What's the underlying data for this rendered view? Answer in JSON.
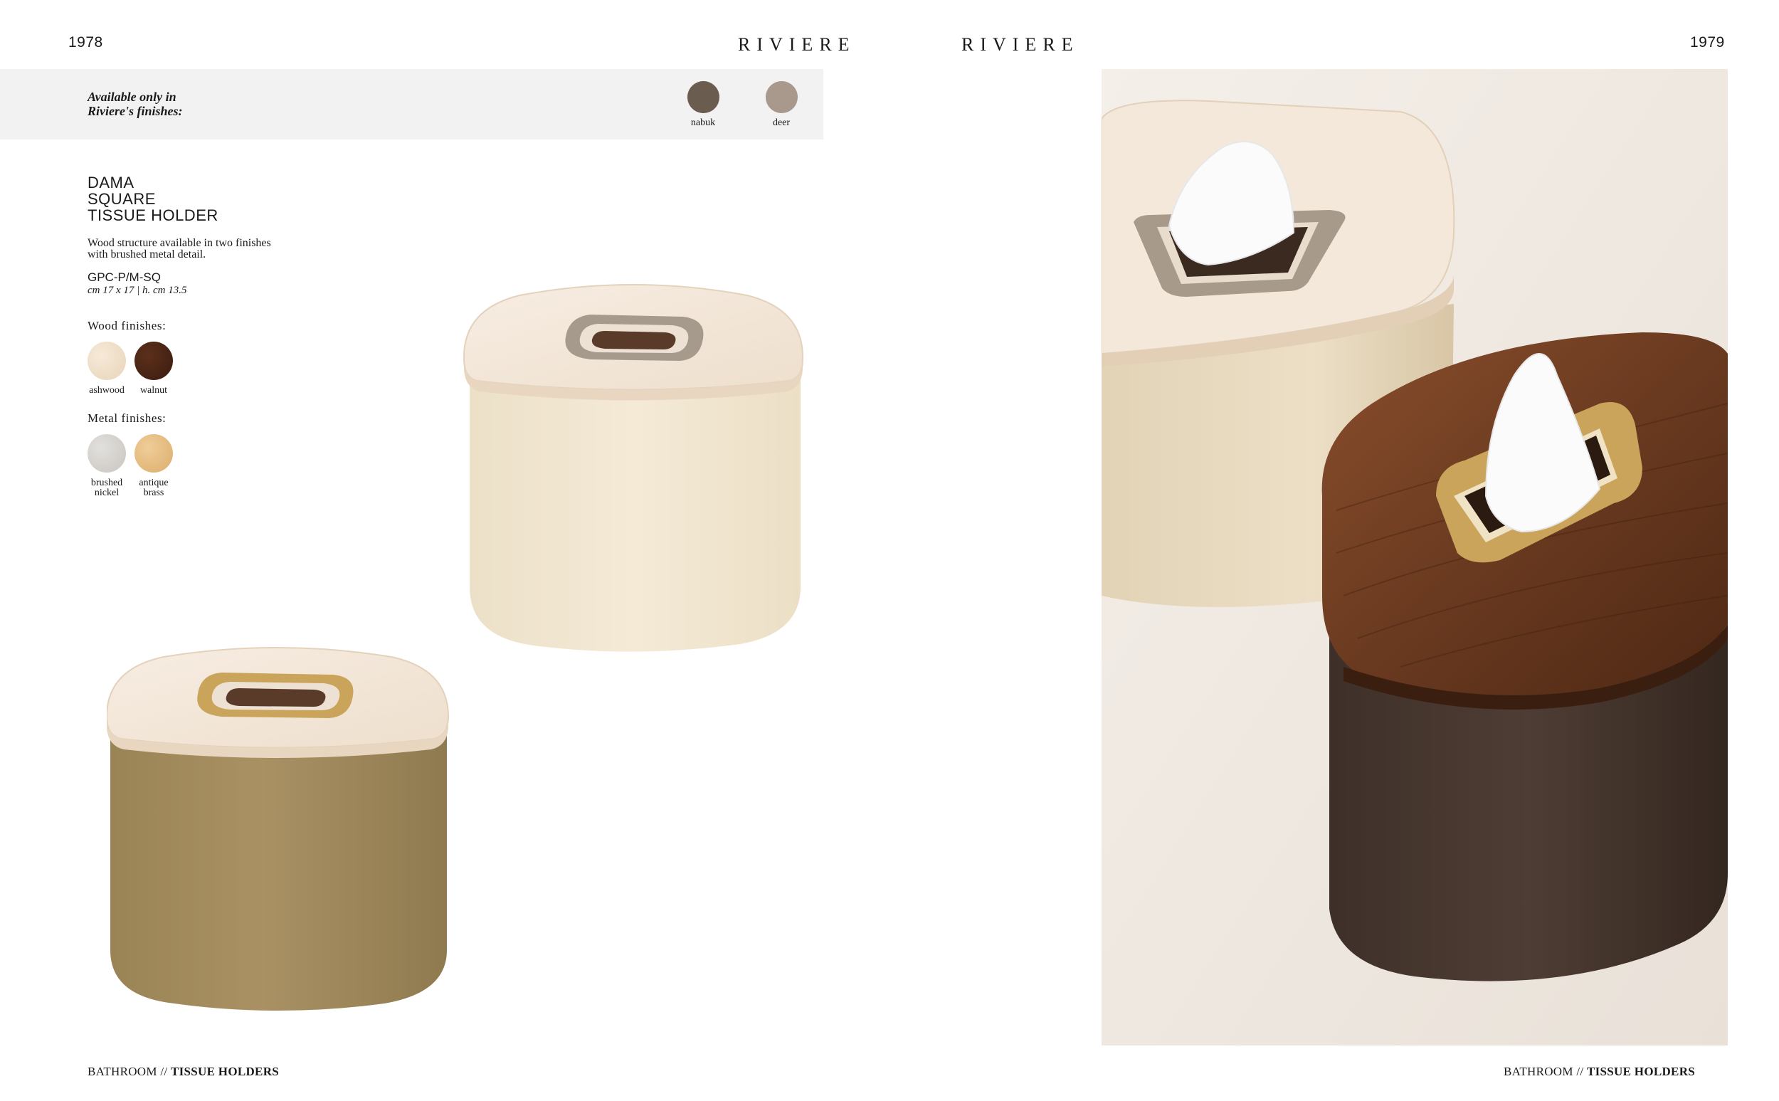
{
  "left_page": {
    "page_number": "1978",
    "brand": "RIVIERE",
    "availability": {
      "label_line1": "Available only in",
      "label_line2": "Riviere's finishes:",
      "finishes": [
        {
          "name": "nabuk",
          "color": "#6b5c50"
        },
        {
          "name": "deer",
          "color": "#a8998c"
        }
      ]
    },
    "product": {
      "title_line1": "DAMA",
      "title_line2": "SQUARE",
      "title_line3": "TISSUE HOLDER",
      "description_line1": "Wood structure available in two finishes",
      "description_line2": "with brushed metal detail.",
      "code": "GPC-P/M-SQ",
      "dimensions": "cm 17 x 17 | h. cm 13.5"
    },
    "wood_finishes": {
      "heading": "Wood  finishes:",
      "items": [
        {
          "line1": "ashwood",
          "line2": "",
          "color": "#ecdcc6"
        },
        {
          "line1": "walnut",
          "line2": "",
          "color": "#4a2616"
        }
      ]
    },
    "metal_finishes": {
      "heading": "Metal  finishes:",
      "items": [
        {
          "line1": "brushed",
          "line2": "nickel",
          "color": "#d6d3cf"
        },
        {
          "line1": "antique",
          "line2": "brass",
          "color": "#e6c08a"
        }
      ]
    },
    "footer": {
      "section": "BATHROOM",
      "separator": " // ",
      "category": "TISSUE HOLDERS"
    }
  },
  "right_page": {
    "page_number": "1979",
    "brand": "RIVIERE",
    "footer": {
      "section": "BATHROOM",
      "separator": " // ",
      "category": "TISSUE HOLDERS"
    }
  },
  "colors": {
    "cream_leather": "#f1e6d0",
    "olive_suede": "#a0895d",
    "dark_leather": "#4a3a32",
    "ash_wood": "#f2e6d8",
    "walnut_wood": "#6a3a20",
    "nickel": "#a59a8c",
    "brass": "#c9a45a"
  }
}
